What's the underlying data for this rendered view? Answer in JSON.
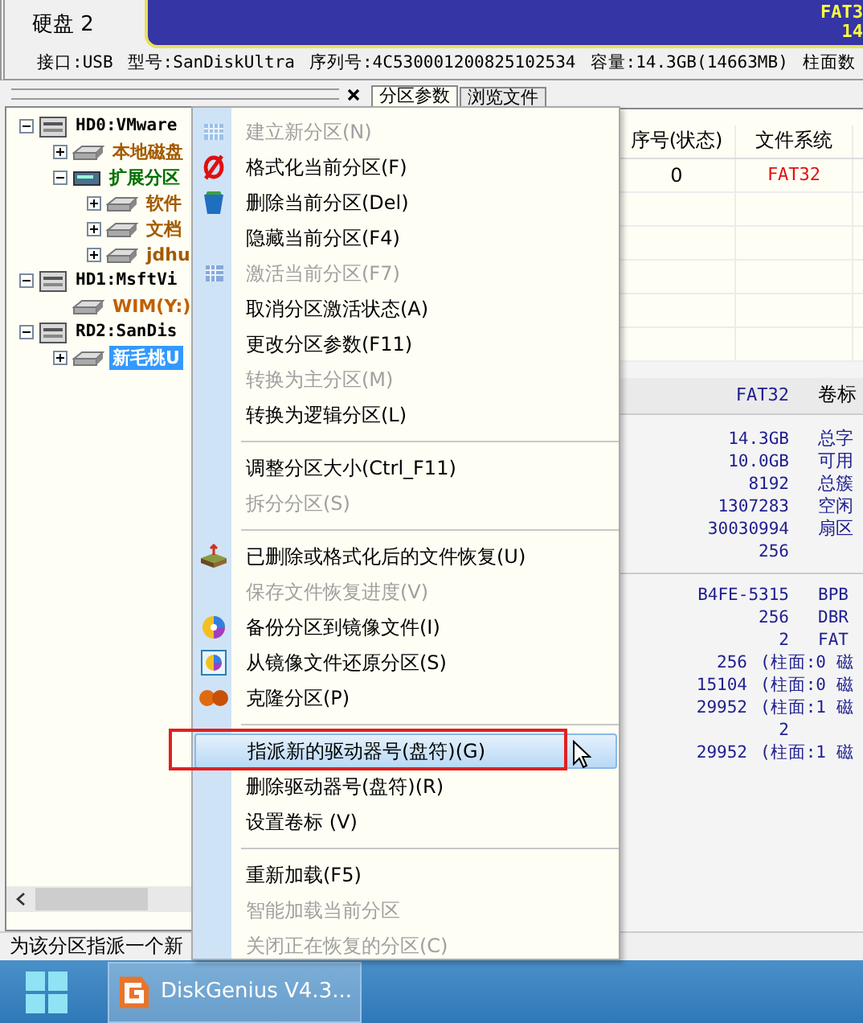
{
  "disk_header": {
    "label": "硬盘 2",
    "bar_texts": [
      "FAT3",
      "14"
    ]
  },
  "disk_info": [
    "接口:USB",
    "型号:SanDiskUltra",
    "序列号:4C530001200825102534",
    "容量:14.3GB(14663MB)",
    "柱面数"
  ],
  "tree": [
    {
      "label": "HD0:VMware",
      "kind": "disk",
      "color": "#000000",
      "expanded": true,
      "selected": false,
      "children": [
        {
          "label": "本地磁盘",
          "kind": "partition",
          "color": "#a35a00",
          "expanded": false,
          "selected": false
        },
        {
          "label": "扩展分区",
          "kind": "extended",
          "color": "#007000",
          "expanded": true,
          "selected": false,
          "children": [
            {
              "label": "软件",
              "kind": "partition",
              "color": "#a35a00",
              "expanded": false,
              "selected": false
            },
            {
              "label": "文档",
              "kind": "partition",
              "color": "#a35a00",
              "expanded": false,
              "selected": false
            },
            {
              "label": "jdhu",
              "kind": "partition",
              "color": "#a35a00",
              "expanded": false,
              "selected": false
            }
          ]
        }
      ]
    },
    {
      "label": "HD1:MsftVi",
      "kind": "disk",
      "color": "#000000",
      "expanded": true,
      "selected": false,
      "children": [
        {
          "label": "WIM(Y:)",
          "kind": "partition",
          "color": "#c06000",
          "selected": false
        }
      ]
    },
    {
      "label": "RD2:SanDis",
      "kind": "disk",
      "color": "#000000",
      "expanded": true,
      "selected": false,
      "children": [
        {
          "label": "新毛桃U",
          "kind": "partition",
          "expanded": false,
          "selected": true
        }
      ]
    }
  ],
  "tabs": [
    {
      "label": "分区参数",
      "selected": true
    },
    {
      "label": "浏览文件",
      "selected": false
    }
  ],
  "partition_table": {
    "columns": [
      "序号(状态)",
      "文件系统"
    ],
    "rows": [
      [
        "0",
        "FAT32"
      ]
    ]
  },
  "details": {
    "filesystem": "FAT32",
    "filesystem_label": "卷标",
    "fields": [
      {
        "value": "14.3GB",
        "label": "总字"
      },
      {
        "value": "10.0GB",
        "label": "可用"
      },
      {
        "value": "8192",
        "label": "总簇"
      },
      {
        "value": "1307283",
        "label": "空闲"
      },
      {
        "value": "30030994",
        "label": "扇区"
      },
      {
        "value": "256"
      }
    ],
    "fields_2": [
      {
        "kind": "plain",
        "value": "B4FE-5315",
        "label": "BPB"
      },
      {
        "kind": "plain",
        "value": "256",
        "label": "DBR"
      },
      {
        "kind": "plain",
        "value": "2",
        "label": "FAT"
      },
      {
        "kind": "chs",
        "value": "256",
        "label": "(柱面:0 磁"
      },
      {
        "kind": "chs",
        "value": "15104",
        "label": "(柱面:0 磁"
      },
      {
        "kind": "chs",
        "value": "29952",
        "label": "(柱面:1 磁"
      },
      {
        "kind": "plain",
        "value": "2"
      },
      {
        "kind": "chs",
        "value": "29952",
        "label": "(柱面:1 磁"
      }
    ]
  },
  "status_bar": "为该分区指派一个新",
  "context_menu": [
    {
      "kind": "item",
      "label": "建立新分区(N)",
      "disabled": true,
      "selected": false
    },
    {
      "kind": "item",
      "label": "格式化当前分区(F)",
      "disabled": false,
      "selected": false
    },
    {
      "kind": "item",
      "label": "删除当前分区(Del)",
      "disabled": false,
      "selected": false
    },
    {
      "kind": "item",
      "label": "隐藏当前分区(F4)",
      "disabled": false,
      "selected": false
    },
    {
      "kind": "item",
      "label": "激活当前分区(F7)",
      "disabled": true,
      "selected": false
    },
    {
      "kind": "item",
      "label": "取消分区激活状态(A)",
      "disabled": false,
      "selected": false
    },
    {
      "kind": "item",
      "label": "更改分区参数(F11)",
      "disabled": false,
      "selected": false
    },
    {
      "kind": "item",
      "label": "转换为主分区(M)",
      "disabled": true,
      "selected": false
    },
    {
      "kind": "item",
      "label": "转换为逻辑分区(L)",
      "disabled": false,
      "selected": false
    },
    {
      "kind": "separator"
    },
    {
      "kind": "item",
      "label": "调整分区大小(Ctrl_F11)",
      "disabled": false,
      "selected": false
    },
    {
      "kind": "item",
      "label": "拆分分区(S)",
      "disabled": true,
      "selected": false
    },
    {
      "kind": "separator"
    },
    {
      "kind": "item",
      "label": "已删除或格式化后的文件恢复(U)",
      "disabled": false,
      "selected": false
    },
    {
      "kind": "item",
      "label": "保存文件恢复进度(V)",
      "disabled": true,
      "selected": false
    },
    {
      "kind": "item",
      "label": "备份分区到镜像文件(I)",
      "disabled": false,
      "selected": false
    },
    {
      "kind": "item",
      "label": "从镜像文件还原分区(S)",
      "disabled": false,
      "selected": false
    },
    {
      "kind": "item",
      "label": "克隆分区(P)",
      "disabled": false,
      "selected": false
    },
    {
      "kind": "separator"
    },
    {
      "kind": "item",
      "label": "指派新的驱动器号(盘符)(G)",
      "disabled": false,
      "selected": true
    },
    {
      "kind": "item",
      "label": "删除驱动器号(盘符)(R)",
      "disabled": false,
      "selected": false
    },
    {
      "kind": "item",
      "label": "设置卷标 (V)",
      "disabled": false,
      "selected": false
    },
    {
      "kind": "separator"
    },
    {
      "kind": "item",
      "label": "重新加载(F5)",
      "disabled": false,
      "selected": false
    },
    {
      "kind": "item",
      "label": "智能加载当前分区",
      "disabled": true,
      "selected": false
    },
    {
      "kind": "item",
      "label": "关闭正在恢复的分区(C)",
      "disabled": true,
      "selected": false
    }
  ],
  "taskbar": {
    "app_label": "DiskGenius V4.3..."
  }
}
